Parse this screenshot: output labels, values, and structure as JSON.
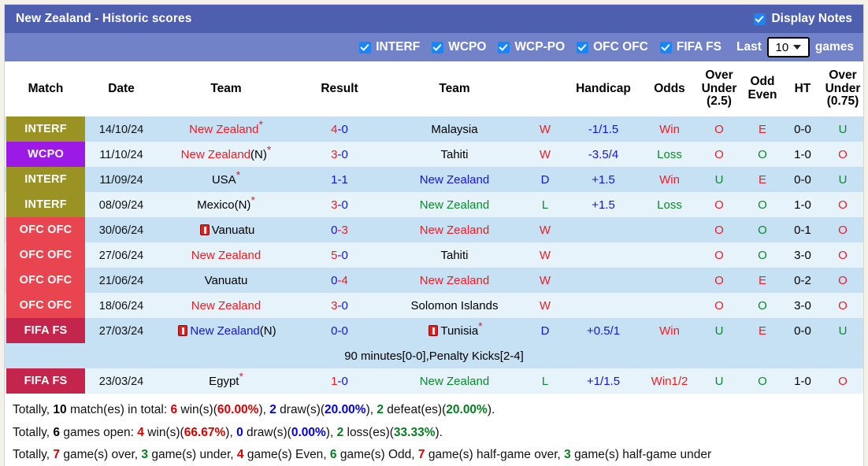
{
  "header": {
    "title": "New Zealand - Historic scores",
    "display_notes_label": "Display Notes",
    "display_notes_checked": true,
    "filters": [
      {
        "label": "INTERF",
        "checked": true
      },
      {
        "label": "WCPO",
        "checked": true
      },
      {
        "label": "WCP-PO",
        "checked": true
      },
      {
        "label": "OFC OFC",
        "checked": true
      },
      {
        "label": "FIFA FS",
        "checked": true
      }
    ],
    "last_label": "Last",
    "last_value": "10",
    "games_label": "games"
  },
  "columns": [
    "Match",
    "Date",
    "Team",
    "Result",
    "Team",
    "",
    "Handicap",
    "Odds",
    "Over\nUnder\n(2.5)",
    "Odd\nEven",
    "HT",
    "Over\nUnder\n(0.75)"
  ],
  "column_headers": {
    "match": "Match",
    "date": "Date",
    "team_home": "Team",
    "result": "Result",
    "team_away": "Team",
    "wdl": "",
    "handicap": "Handicap",
    "odds": "Odds",
    "ou25_l1": "Over",
    "ou25_l2": "Under",
    "ou25_l3": "(2.5)",
    "oddeven_l1": "Odd",
    "oddeven_l2": "Even",
    "ht": "HT",
    "ou075_l1": "Over",
    "ou075_l2": "Under",
    "ou075_l3": "(0.75)"
  },
  "rows": [
    {
      "comp": "INTERF",
      "comp_class": "interf",
      "date": "14/10/24",
      "home": "New Zealand",
      "home_color": "red",
      "home_star": true,
      "home_suffix": "",
      "home_card": false,
      "score_a": "4",
      "score_a_color": "red",
      "score_b": "0",
      "score_b_color": "blue",
      "away": "Malaysia",
      "away_color": "black",
      "away_star": false,
      "away_card": false,
      "wdl": "W",
      "wdl_color": "red",
      "handicap": "-1/1.5",
      "odds": "Win",
      "odds_color": "red",
      "ou25": "O",
      "ou25_color": "red",
      "oddeven": "E",
      "oddeven_color": "red",
      "ht": "0-0",
      "ou075": "U",
      "ou075_color": "green",
      "note": null
    },
    {
      "comp": "WCPO",
      "comp_class": "wcpo",
      "date": "11/10/24",
      "home": "New Zealand",
      "home_color": "red",
      "home_star": true,
      "home_suffix": "(N)",
      "home_card": false,
      "score_a": "3",
      "score_a_color": "red",
      "score_b": "0",
      "score_b_color": "blue",
      "away": "Tahiti",
      "away_color": "black",
      "away_star": false,
      "away_card": false,
      "wdl": "W",
      "wdl_color": "red",
      "handicap": "-3.5/4",
      "odds": "Loss",
      "odds_color": "green",
      "ou25": "O",
      "ou25_color": "red",
      "oddeven": "O",
      "oddeven_color": "green",
      "ht": "1-0",
      "ou075": "O",
      "ou075_color": "red",
      "note": null
    },
    {
      "comp": "INTERF",
      "comp_class": "interf",
      "date": "11/09/24",
      "home": "USA",
      "home_color": "black",
      "home_star": true,
      "home_suffix": "",
      "home_card": false,
      "score_a": "1",
      "score_a_color": "blue",
      "score_b": "1",
      "score_b_color": "blue",
      "away": "New Zealand",
      "away_color": "blue",
      "away_star": false,
      "away_card": false,
      "wdl": "D",
      "wdl_color": "blue",
      "handicap": "+1.5",
      "odds": "Win",
      "odds_color": "red",
      "ou25": "U",
      "ou25_color": "green",
      "oddeven": "E",
      "oddeven_color": "red",
      "ht": "0-0",
      "ou075": "U",
      "ou075_color": "green",
      "note": null
    },
    {
      "comp": "INTERF",
      "comp_class": "interf",
      "date": "08/09/24",
      "home": "Mexico",
      "home_color": "black",
      "home_star": true,
      "home_suffix": "(N)",
      "home_card": false,
      "score_a": "3",
      "score_a_color": "red",
      "score_b": "0",
      "score_b_color": "blue",
      "away": "New Zealand",
      "away_color": "green",
      "away_star": false,
      "away_card": false,
      "wdl": "L",
      "wdl_color": "green",
      "handicap": "+1.5",
      "odds": "Loss",
      "odds_color": "green",
      "ou25": "O",
      "ou25_color": "red",
      "oddeven": "O",
      "oddeven_color": "green",
      "ht": "1-0",
      "ou075": "O",
      "ou075_color": "red",
      "note": null
    },
    {
      "comp": "OFC OFC",
      "comp_class": "ofc",
      "date": "30/06/24",
      "home": "Vanuatu",
      "home_color": "black",
      "home_star": false,
      "home_suffix": "",
      "home_card": true,
      "score_a": "0",
      "score_a_color": "blue",
      "score_b": "3",
      "score_b_color": "red",
      "away": "New Zealand",
      "away_color": "red",
      "away_star": false,
      "away_card": false,
      "wdl": "W",
      "wdl_color": "red",
      "handicap": "",
      "odds": "",
      "odds_color": "black",
      "ou25": "O",
      "ou25_color": "red",
      "oddeven": "O",
      "oddeven_color": "green",
      "ht": "0-1",
      "ou075": "O",
      "ou075_color": "red",
      "note": null
    },
    {
      "comp": "OFC OFC",
      "comp_class": "ofc",
      "date": "27/06/24",
      "home": "New Zealand",
      "home_color": "red",
      "home_star": false,
      "home_suffix": "",
      "home_card": false,
      "score_a": "5",
      "score_a_color": "red",
      "score_b": "0",
      "score_b_color": "blue",
      "away": "Tahiti",
      "away_color": "black",
      "away_star": false,
      "away_card": false,
      "wdl": "W",
      "wdl_color": "red",
      "handicap": "",
      "odds": "",
      "odds_color": "black",
      "ou25": "O",
      "ou25_color": "red",
      "oddeven": "O",
      "oddeven_color": "green",
      "ht": "3-0",
      "ou075": "O",
      "ou075_color": "red",
      "note": null
    },
    {
      "comp": "OFC OFC",
      "comp_class": "ofc",
      "date": "21/06/24",
      "home": "Vanuatu",
      "home_color": "black",
      "home_star": false,
      "home_suffix": "",
      "home_card": false,
      "score_a": "0",
      "score_a_color": "blue",
      "score_b": "4",
      "score_b_color": "red",
      "away": "New Zealand",
      "away_color": "red",
      "away_star": false,
      "away_card": false,
      "wdl": "W",
      "wdl_color": "red",
      "handicap": "",
      "odds": "",
      "odds_color": "black",
      "ou25": "O",
      "ou25_color": "red",
      "oddeven": "E",
      "oddeven_color": "red",
      "ht": "0-2",
      "ou075": "O",
      "ou075_color": "red",
      "note": null
    },
    {
      "comp": "OFC OFC",
      "comp_class": "ofc",
      "date": "18/06/24",
      "home": "New Zealand",
      "home_color": "red",
      "home_star": false,
      "home_suffix": "",
      "home_card": false,
      "score_a": "3",
      "score_a_color": "red",
      "score_b": "0",
      "score_b_color": "blue",
      "away": "Solomon Islands",
      "away_color": "black",
      "away_star": false,
      "away_card": false,
      "wdl": "W",
      "wdl_color": "red",
      "handicap": "",
      "odds": "",
      "odds_color": "black",
      "ou25": "O",
      "ou25_color": "red",
      "oddeven": "O",
      "oddeven_color": "green",
      "ht": "3-0",
      "ou075": "O",
      "ou075_color": "red",
      "note": null
    },
    {
      "comp": "FIFA FS",
      "comp_class": "fifa",
      "date": "27/03/24",
      "home": "New Zealand",
      "home_color": "blue",
      "home_star": false,
      "home_suffix": "(N)",
      "home_card": true,
      "score_a": "0",
      "score_a_color": "blue",
      "score_b": "0",
      "score_b_color": "blue",
      "away": "Tunisia",
      "away_color": "black",
      "away_star": true,
      "away_card": true,
      "wdl": "D",
      "wdl_color": "blue",
      "handicap": "+0.5/1",
      "odds": "Win",
      "odds_color": "red",
      "ou25": "U",
      "ou25_color": "green",
      "oddeven": "E",
      "oddeven_color": "red",
      "ht": "0-0",
      "ou075": "U",
      "ou075_color": "green",
      "note": "90 minutes[0-0],Penalty Kicks[2-4]"
    },
    {
      "comp": "FIFA FS",
      "comp_class": "fifa",
      "date": "23/03/24",
      "home": "Egypt",
      "home_color": "black",
      "home_star": true,
      "home_suffix": "",
      "home_card": false,
      "score_a": "1",
      "score_a_color": "red",
      "score_b": "0",
      "score_b_color": "blue",
      "away": "New Zealand",
      "away_color": "green",
      "away_star": false,
      "away_card": false,
      "wdl": "L",
      "wdl_color": "green",
      "handicap": "+1/1.5",
      "odds": "Win1/2",
      "odds_color": "red",
      "ou25": "U",
      "ou25_color": "green",
      "oddeven": "O",
      "oddeven_color": "green",
      "ht": "1-0",
      "ou075": "O",
      "ou075_color": "red",
      "note": null
    }
  ],
  "summary": {
    "line1": [
      {
        "t": "Totally, ",
        "c": "plain"
      },
      {
        "t": "10",
        "c": "black"
      },
      {
        "t": " match(es) in total: ",
        "c": "plain"
      },
      {
        "t": "6",
        "c": "red"
      },
      {
        "t": " win(s)(",
        "c": "plain"
      },
      {
        "t": "60.00%",
        "c": "red"
      },
      {
        "t": "), ",
        "c": "plain"
      },
      {
        "t": "2",
        "c": "blue"
      },
      {
        "t": " draw(s)(",
        "c": "plain"
      },
      {
        "t": "20.00%",
        "c": "blue"
      },
      {
        "t": "), ",
        "c": "plain"
      },
      {
        "t": "2",
        "c": "green"
      },
      {
        "t": " defeat(es)(",
        "c": "plain"
      },
      {
        "t": "20.00%",
        "c": "green"
      },
      {
        "t": ").",
        "c": "plain"
      }
    ],
    "line2": [
      {
        "t": "Totally, ",
        "c": "plain"
      },
      {
        "t": "6",
        "c": "black"
      },
      {
        "t": " games open: ",
        "c": "plain"
      },
      {
        "t": "4",
        "c": "red"
      },
      {
        "t": " win(s)(",
        "c": "plain"
      },
      {
        "t": "66.67%",
        "c": "red"
      },
      {
        "t": "), ",
        "c": "plain"
      },
      {
        "t": "0",
        "c": "blue"
      },
      {
        "t": " draw(s)(",
        "c": "plain"
      },
      {
        "t": "0.00%",
        "c": "blue"
      },
      {
        "t": "), ",
        "c": "plain"
      },
      {
        "t": "2",
        "c": "green"
      },
      {
        "t": " loss(es)(",
        "c": "plain"
      },
      {
        "t": "33.33%",
        "c": "green"
      },
      {
        "t": ").",
        "c": "plain"
      }
    ],
    "line3": [
      {
        "t": "Totally, ",
        "c": "plain"
      },
      {
        "t": "7",
        "c": "red"
      },
      {
        "t": " game(s) over, ",
        "c": "plain"
      },
      {
        "t": "3",
        "c": "green"
      },
      {
        "t": " game(s) under, ",
        "c": "plain"
      },
      {
        "t": "4",
        "c": "red"
      },
      {
        "t": " game(s) Even, ",
        "c": "plain"
      },
      {
        "t": "6",
        "c": "green"
      },
      {
        "t": " game(s) Odd, ",
        "c": "plain"
      },
      {
        "t": "7",
        "c": "red"
      },
      {
        "t": " game(s) half-game over, ",
        "c": "plain"
      },
      {
        "t": "3",
        "c": "green"
      },
      {
        "t": " game(s) half-game under",
        "c": "plain"
      }
    ]
  },
  "colors": {
    "titlebar": "#4e5fb0",
    "filterbar": "#7182c8",
    "row_odd": "#c6e0f4",
    "row_even": "#e6f3fb",
    "badge_interf": "#9a9223",
    "badge_wcpo": "#9b1ae6",
    "badge_ofc": "#e84551",
    "badge_fifa": "#c4254d",
    "accent_red": "#ee1c25",
    "accent_blue": "#1316d6",
    "accent_green": "#0a8a2e"
  }
}
